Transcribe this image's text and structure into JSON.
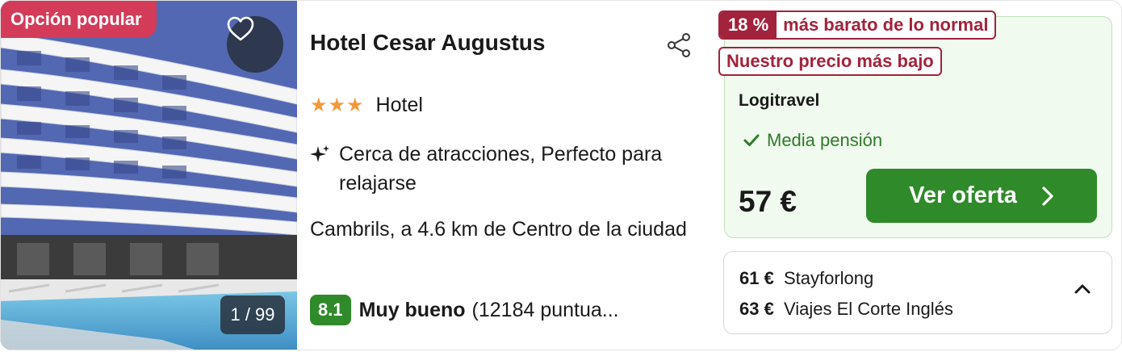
{
  "photo": {
    "popular_badge": "Opción popular",
    "counter": "1 / 99",
    "favorite_icon": "heart-outline-icon"
  },
  "hotel": {
    "name": "Hotel Cesar Augustus",
    "stars": "★★★",
    "type": "Hotel",
    "features": "Cerca de atracciones, Perfecto para relajarse",
    "location": "Cambrils, a 4.6 km de Centro de la ciudad",
    "score": "8.1",
    "rating_label": "Muy bueno",
    "reviews": "(12184 puntua..."
  },
  "deal": {
    "discount_pct": "18 %",
    "discount_label": "más barato de lo normal",
    "lowest_price_tag": "Nuestro precio más bajo",
    "provider": "Logitravel",
    "board": "Media pensión",
    "price": "57 €",
    "cta_label": "Ver oferta",
    "accent_color": "#2f8a2a",
    "tag_color": "#a2233b"
  },
  "alternatives": [
    {
      "price": "61 €",
      "provider": "Stayforlong"
    },
    {
      "price": "63 €",
      "provider": "Viajes El Corte Inglés"
    }
  ]
}
